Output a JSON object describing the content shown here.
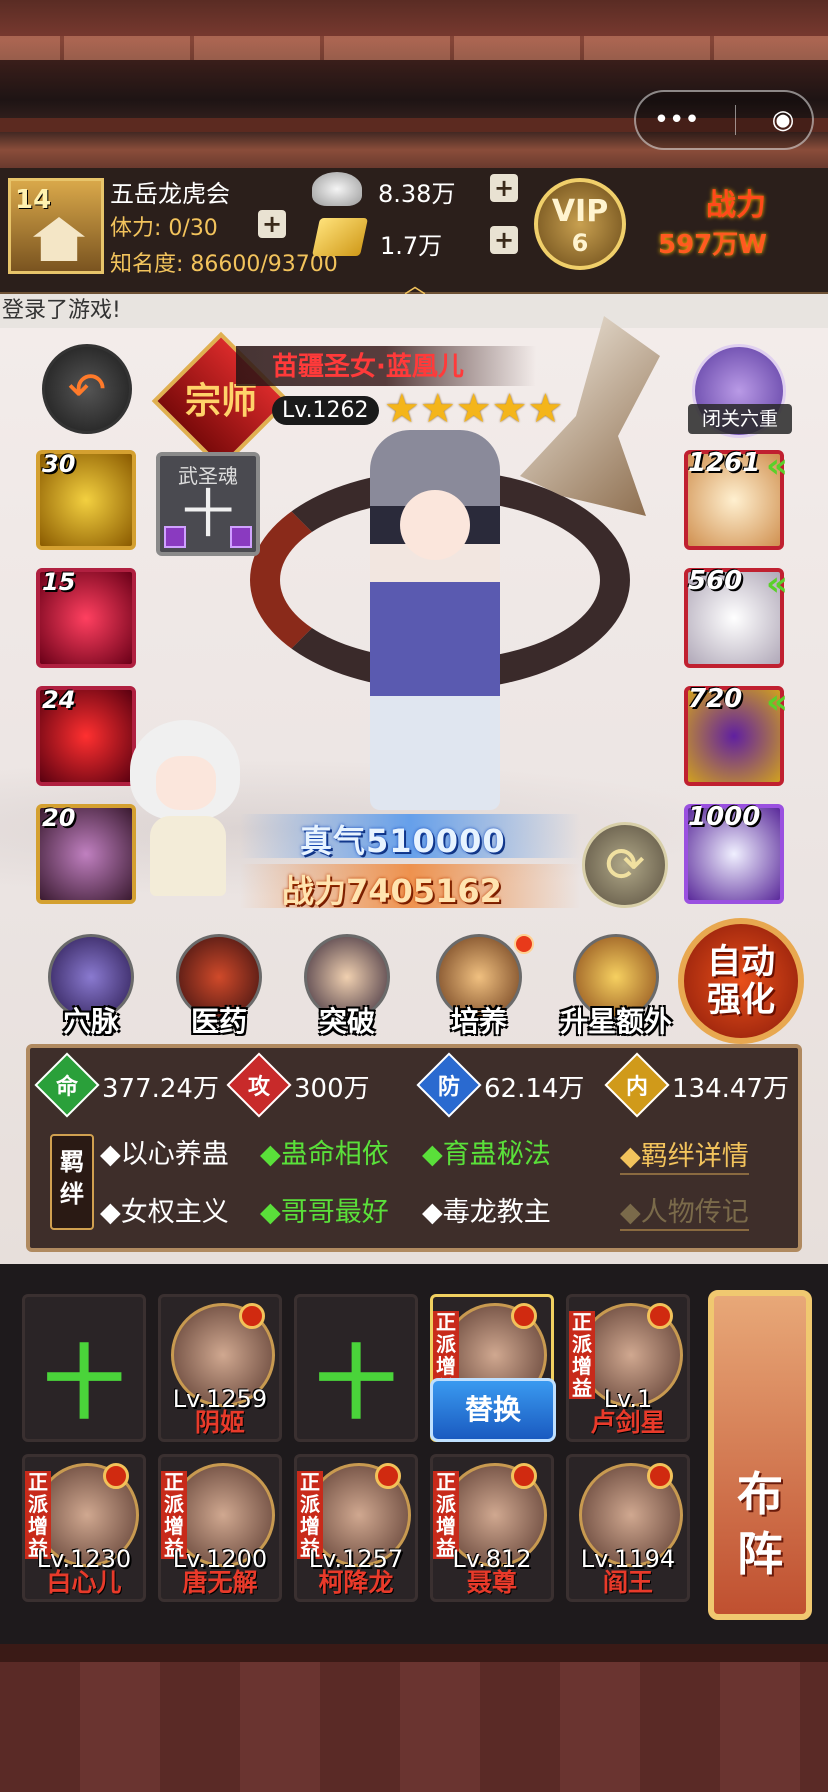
{
  "top": {
    "capsule_more": "•••",
    "capsule_close": "◉"
  },
  "player": {
    "level": "14",
    "guild": "五岳龙虎会",
    "stamina_label": "体力: 0/30",
    "fame_label": "知名度: 86600/93700",
    "silver": "8.38万",
    "gold": "1.7万",
    "vip_label": "VIP",
    "vip_level": "6",
    "power_label": "战力",
    "power_value": "597万W"
  },
  "notice": "登录了游戏!",
  "hero": {
    "rank_badge": "宗师",
    "name": "苗疆圣女·蓝凰儿",
    "level": "Lv.1262",
    "stars": 5,
    "stars_text": "★★★★★",
    "seclusion_label": "闭关六重",
    "qi": "真气510000",
    "power": "战力7405162"
  },
  "left_slots": [
    {
      "count": "30",
      "icon": "golden-swirl-icon"
    },
    {
      "count": "15",
      "icon": "skull-technique-icon"
    },
    {
      "count": "24",
      "icon": "crimson-seal-icon"
    },
    {
      "count": "20",
      "icon": "orb-technique-icon"
    }
  ],
  "wusheng": {
    "label": "武圣魂",
    "plus": "十"
  },
  "right_slots": [
    {
      "count": "1261",
      "icon": "conch-icon",
      "upgrade": true
    },
    {
      "count": "560",
      "icon": "robe-icon",
      "upgrade": true
    },
    {
      "count": "720",
      "icon": "lantern-orb-icon",
      "upgrade": true
    },
    {
      "count": "1000",
      "icon": "white-eagle-icon",
      "upgrade": false
    }
  ],
  "features": [
    {
      "label": "穴脉",
      "dot": false
    },
    {
      "label": "医药",
      "dot": false
    },
    {
      "label": "突破",
      "dot": false
    },
    {
      "label": "培养",
      "dot": true
    },
    {
      "label": "升星额外",
      "dot": false
    }
  ],
  "auto_strengthen": [
    "自动",
    "强化"
  ],
  "stats": [
    {
      "icon": "命",
      "value": "377.24万",
      "color": "#2aa03a"
    },
    {
      "icon": "攻",
      "value": "300万",
      "color": "#c82a2a"
    },
    {
      "icon": "防",
      "value": "62.14万",
      "color": "#2a6ad0"
    },
    {
      "icon": "内",
      "value": "134.47万",
      "color": "#d09a1a"
    }
  ],
  "fetter_badge": "羁绊",
  "fetters_row1": [
    "◆以心养蛊",
    "◆蛊命相依",
    "◆育蛊秘法"
  ],
  "fetters_row2": [
    "◆女权主义",
    "◆哥哥最好",
    "◆毒龙教主"
  ],
  "fetter_links": [
    "◆羁绊详情",
    "◆人物传记"
  ],
  "lineup": [
    {
      "name": "",
      "level": "",
      "empty": true
    },
    {
      "name": "阴姬",
      "level": "Lv.1259",
      "tag": "",
      "dot": true
    },
    {
      "name": "",
      "level": "",
      "empty": true
    },
    {
      "name": "",
      "level": "",
      "tag": "正派增益",
      "dot": true,
      "selected": true
    },
    {
      "name": "卢剑星",
      "level": "Lv.1",
      "tag": "正派增益",
      "dot": true
    },
    {
      "name": "白心儿",
      "level": "Lv.1230",
      "tag": "正派增益",
      "dot": true
    },
    {
      "name": "唐无解",
      "level": "Lv.1200",
      "tag": "正派增益",
      "dot": false
    },
    {
      "name": "柯降龙",
      "level": "Lv.1257",
      "tag": "正派增益",
      "dot": true
    },
    {
      "name": "聂尊",
      "level": "Lv.812",
      "tag": "正派增益",
      "dot": true
    },
    {
      "name": "阎王",
      "level": "Lv.1194",
      "tag": "",
      "dot": true
    }
  ],
  "replace_label": "替换",
  "formation_label": [
    "布",
    "阵"
  ],
  "lineup_plus": "十",
  "colors": {
    "accent_gold": "#f2c35c",
    "name_red": "#e83a2a",
    "fetter_green": "#5ae03a"
  }
}
